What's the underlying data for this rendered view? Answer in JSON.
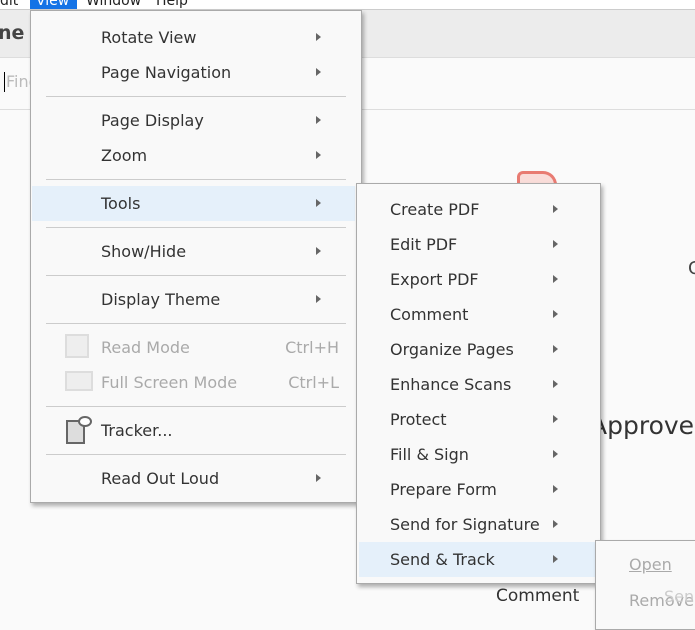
{
  "menubar": {
    "items": [
      "dit",
      "View",
      "Window",
      "Help"
    ],
    "active": "View"
  },
  "background": {
    "toolbar_label": "ne",
    "find_placeholder": "Find",
    "text_c": "C",
    "text_approve": "Approve",
    "text_comment": "Comment",
    "text_sen": "Sen"
  },
  "view_menu": {
    "items": [
      {
        "label": "Rotate View",
        "submenu": true
      },
      {
        "label": "Page Navigation",
        "submenu": true
      },
      {
        "label": "Page Display",
        "submenu": true
      },
      {
        "label": "Zoom",
        "submenu": true
      },
      {
        "label": "Tools",
        "submenu": true,
        "highlighted": true
      },
      {
        "label": "Show/Hide",
        "submenu": true
      },
      {
        "label": "Display Theme",
        "submenu": true
      },
      {
        "label": "Read Mode",
        "shortcut": "Ctrl+H",
        "disabled": true
      },
      {
        "label": "Full Screen Mode",
        "shortcut": "Ctrl+L",
        "disabled": true
      },
      {
        "label": "Tracker..."
      },
      {
        "label": "Read Out Loud",
        "submenu": true
      }
    ]
  },
  "tools_menu": {
    "items": [
      "Create PDF",
      "Edit PDF",
      "Export PDF",
      "Comment",
      "Organize Pages",
      "Enhance Scans",
      "Protect",
      "Fill & Sign",
      "Prepare Form",
      "Send for Signature",
      "Send & Track"
    ],
    "highlighted": "Send & Track"
  },
  "send_track_menu": {
    "items": [
      "Open",
      "Remove"
    ]
  },
  "colors": {
    "accent": "#1473e6",
    "highlight": "#e5f0fa"
  }
}
